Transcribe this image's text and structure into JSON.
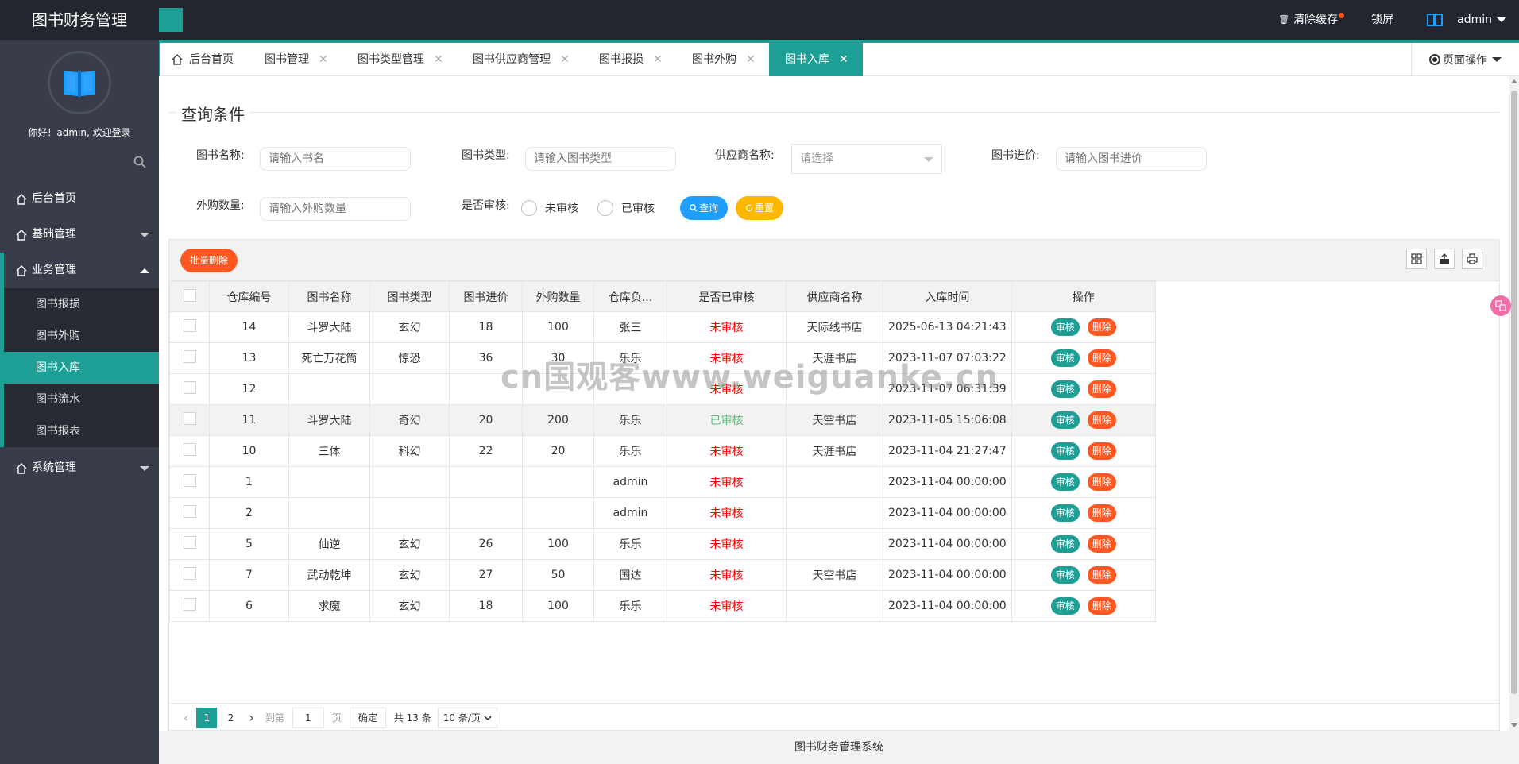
{
  "header": {
    "logo": "图书财务管理",
    "clear_cache": "清除缓存",
    "lock_screen": "锁屏",
    "user": "admin"
  },
  "sidebar": {
    "welcome": "你好！admin, 欢迎登录",
    "items": [
      {
        "label": "后台首页"
      },
      {
        "label": "基础管理"
      },
      {
        "label": "业务管理"
      },
      {
        "label": "系统管理"
      }
    ],
    "sub_items": [
      {
        "label": "图书报损"
      },
      {
        "label": "图书外购"
      },
      {
        "label": "图书入库"
      },
      {
        "label": "图书流水"
      },
      {
        "label": "图书报表"
      }
    ]
  },
  "tabs": [
    {
      "label": "后台首页"
    },
    {
      "label": "图书管理"
    },
    {
      "label": "图书类型管理"
    },
    {
      "label": "图书供应商管理"
    },
    {
      "label": "图书报损"
    },
    {
      "label": "图书外购"
    },
    {
      "label": "图书入库"
    }
  ],
  "page_ops": "页面操作",
  "query": {
    "title": "查询条件",
    "book_name_label": "图书名称:",
    "book_name_placeholder": "请输入书名",
    "book_type_label": "图书类型:",
    "book_type_placeholder": "请输入图书类型",
    "supplier_label": "供应商名称:",
    "supplier_placeholder": "请选择",
    "price_label": "图书进价:",
    "price_placeholder": "请输入图书进价",
    "qty_label": "外购数量:",
    "qty_placeholder": "请输入外购数量",
    "audit_label": "是否审核:",
    "radio_unaudited": "未审核",
    "radio_audited": "已审核",
    "search_btn": "查询",
    "reset_btn": "重置"
  },
  "table": {
    "batch_delete": "批量删除",
    "headers": [
      "仓库编号",
      "图书名称",
      "图书类型",
      "图书进价",
      "外购数量",
      "仓库负...",
      "是否已审核",
      "供应商名称",
      "入库时间",
      "操作"
    ],
    "audit_btn": "审核",
    "delete_btn": "删除",
    "rows": [
      [
        "14",
        "斗罗大陆",
        "玄幻",
        "18",
        "100",
        "张三",
        "未审核",
        "天际线书店",
        "2025-06-13 04:21:43"
      ],
      [
        "13",
        "死亡万花筒",
        "惊恐",
        "36",
        "30",
        "乐乐",
        "未审核",
        "天涯书店",
        "2023-11-07 07:03:22"
      ],
      [
        "12",
        "",
        "",
        "",
        "",
        "",
        "未审核",
        "",
        "2023-11-07 06:31:39"
      ],
      [
        "11",
        "斗罗大陆",
        "奇幻",
        "20",
        "200",
        "乐乐",
        "已审核",
        "天空书店",
        "2023-11-05 15:06:08"
      ],
      [
        "10",
        "三体",
        "科幻",
        "22",
        "20",
        "乐乐",
        "未审核",
        "天涯书店",
        "2023-11-04 21:27:47"
      ],
      [
        "1",
        "",
        "",
        "",
        "",
        "admin",
        "未审核",
        "",
        "2023-11-04 00:00:00"
      ],
      [
        "2",
        "",
        "",
        "",
        "",
        "admin",
        "未审核",
        "",
        "2023-11-04 00:00:00"
      ],
      [
        "5",
        "仙逆",
        "玄幻",
        "26",
        "100",
        "乐乐",
        "未审核",
        "",
        "2023-11-04 00:00:00"
      ],
      [
        "7",
        "武动乾坤",
        "玄幻",
        "27",
        "50",
        "国达",
        "未审核",
        "天空书店",
        "2023-11-04 00:00:00"
      ],
      [
        "6",
        "求魔",
        "玄幻",
        "18",
        "100",
        "乐乐",
        "未审核",
        "",
        "2023-11-04 00:00:00"
      ]
    ]
  },
  "pager": {
    "page1": "1",
    "page2": "2",
    "goto_prefix": "到第",
    "goto_value": "1",
    "goto_suffix": "页",
    "confirm": "确定",
    "total": "共 13 条",
    "per_page": "10 条/页"
  },
  "watermark": "cn国观客www.weiguanke.cn",
  "footer": "图书财务管理系统",
  "colors": {
    "accent": "#1e9f95",
    "danger": "#ff5722",
    "warn": "#ffb800",
    "info": "#1e9fff"
  }
}
